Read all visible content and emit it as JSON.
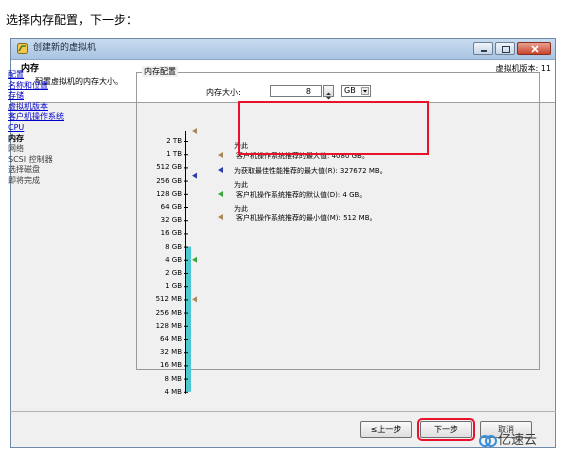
{
  "caption": "选择内存配置，下一步：",
  "window": {
    "title": "创建新的虚拟机"
  },
  "header": {
    "title": "内存",
    "subtitle": "配置虚拟机的内存大小。",
    "version": "虚拟机版本: 11"
  },
  "nav": {
    "items": [
      {
        "label": "配置",
        "state": "done"
      },
      {
        "label": "名称和位置",
        "state": "done"
      },
      {
        "label": "存储",
        "state": "done"
      },
      {
        "label": "虚拟机版本",
        "state": "done"
      },
      {
        "label": "客户机操作系统",
        "state": "done"
      },
      {
        "label": "CPU",
        "state": "done"
      },
      {
        "label": "内存",
        "state": "current"
      },
      {
        "label": "网络",
        "state": "future"
      },
      {
        "label": "SCSI 控制器",
        "state": "future"
      },
      {
        "label": "选择磁盘",
        "state": "future"
      },
      {
        "label": "即将完成",
        "state": "future"
      }
    ]
  },
  "memory": {
    "group_title": "内存配置",
    "size_label": "内存大小:",
    "value": "8",
    "unit": "GB",
    "scale_labels": [
      "2 TB",
      "1 TB",
      "512 GB",
      "256 GB",
      "128 GB",
      "64 GB",
      "32 GB",
      "16 GB",
      "8 GB",
      "4 GB",
      "2 GB",
      "1 GB",
      "512 MB",
      "256 MB",
      "128 MB",
      "64 MB",
      "32 MB",
      "16 MB",
      "8 MB",
      "4 MB"
    ],
    "info": {
      "max_os_line1": "为此",
      "max_os_line2": "客户机操作系统推荐的最大值: 4080 GB。",
      "max_perf": "为获取最佳性能推荐的最大值(R): 327672 MB。",
      "default_line1": "为此",
      "default_line2": "客户机操作系统推荐的默认值(D): 4 GB。",
      "min_line1": "为此",
      "min_line2": "客户机操作系统推荐的最小值(M): 512 MB。"
    },
    "colors": {
      "bar": "#4cc7d2",
      "max_os_marker": "#a8895a",
      "max_perf_marker": "#2a3ea6",
      "default_marker": "#3aa83a",
      "min_marker": "#a8895a",
      "highlight": "#e8132a"
    }
  },
  "buttons": {
    "back": "≤上一步",
    "next": "下一步",
    "cancel": "取消"
  },
  "watermark": {
    "text": "亿速云",
    "icon": "cloud-logo-icon"
  }
}
